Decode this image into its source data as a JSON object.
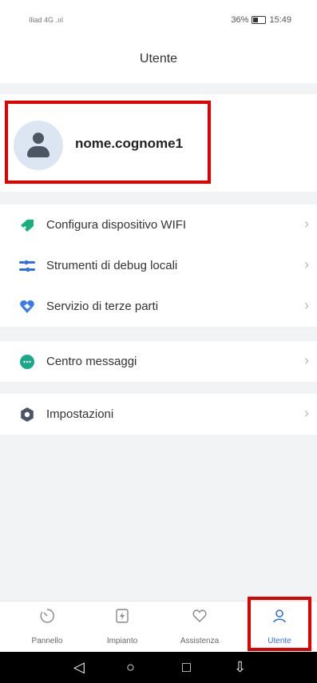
{
  "status": {
    "carrier": "Iliad 4G .ııl",
    "signal_battery": "36%",
    "time": "15:49"
  },
  "header": {
    "title": "Utente"
  },
  "profile": {
    "username": "nome.cognome1"
  },
  "menu": {
    "group1": [
      {
        "label": "Configura dispositivo WIFI",
        "icon": "wifi-tag-icon"
      },
      {
        "label": "Strumenti di debug locali",
        "icon": "debug-tools-icon"
      },
      {
        "label": "Servizio di terze parti",
        "icon": "third-party-service-icon"
      }
    ],
    "group2": [
      {
        "label": "Centro messaggi",
        "icon": "chat-bubble-icon"
      }
    ],
    "group3": [
      {
        "label": "Impostazioni",
        "icon": "gear-icon"
      }
    ]
  },
  "tabs": [
    {
      "label": "Pannello",
      "icon": "dial-icon"
    },
    {
      "label": "Impianto",
      "icon": "plant-icon"
    },
    {
      "label": "Assistenza",
      "icon": "heart-icon"
    },
    {
      "label": "Utente",
      "icon": "user-icon"
    }
  ],
  "colors": {
    "active": "#2f6ee8",
    "highlight": "#e00000"
  }
}
